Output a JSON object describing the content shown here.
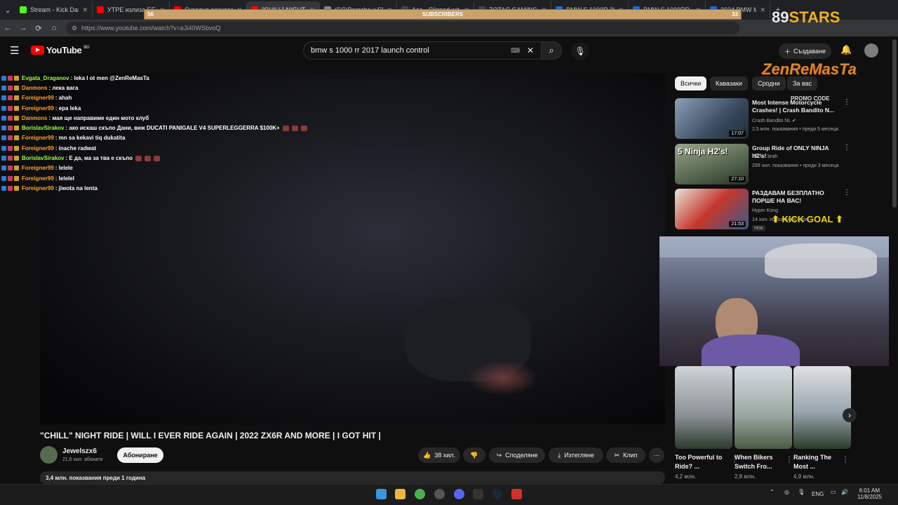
{
  "browser": {
    "tabs": [
      {
        "label": "Stream - Kick Dashb",
        "color": "#53fc18"
      },
      {
        "label": "УТРЕ излиза EЕ",
        "color": "#ff0000"
      },
      {
        "label": "Скрояна разкове",
        "color": "#ff0000"
      },
      {
        "label": "\"CHILL\" NIGHT...",
        "color": "#ff0000"
      },
      {
        "label": "(SC)Porsche x SMF",
        "color": "#888888"
      },
      {
        "label": "Ace - Clipped wit",
        "color": "#444444"
      },
      {
        "label": "ZOTAC GAMING G",
        "color": "#444444"
      },
      {
        "label": "BMW S 1000R 201",
        "color": "#1c69d4"
      },
      {
        "label": "BMW S 1000RR V",
        "color": "#1c69d4"
      },
      {
        "label": "2024 BMW M 1000",
        "color": "#1c69d4"
      }
    ],
    "url": "https://www.youtube.com/watch?v=eJi40WSbvoQ"
  },
  "youtube": {
    "logo_text": "YouTube",
    "region": "BG",
    "search_value": "bmw s 1000 rr 2017 launch control",
    "create_label": "Създаване"
  },
  "chat": [
    {
      "user": "Evgata_Draganov",
      "msg": ": leka I ot men @ZenReMasTa",
      "color": "#9cff4a",
      "emotes": 0
    },
    {
      "user": "Danmons",
      "msg": ": лека вага",
      "color": "#ff9f2e",
      "emotes": 0
    },
    {
      "user": "Foreigner99",
      "msg": ": ahah",
      "color": "#ff9f2e",
      "emotes": 0
    },
    {
      "user": "Foreigner99",
      "msg": ": epa leka",
      "color": "#ff9f2e",
      "emotes": 0
    },
    {
      "user": "Danmons",
      "msg": ": мая ще направиме един мото клуб",
      "color": "#ff9f2e",
      "emotes": 0
    },
    {
      "user": "BorislavSirakov",
      "msg": ": ако искаш скъпо Дани, виж DUCATI PANIGALE V4 SUPERLEGGERRA $100K+",
      "color": "#9cff4a",
      "emotes": 3
    },
    {
      "user": "Foreigner99",
      "msg": ": mn sa kekavi tiq dukatita",
      "color": "#ff9f2e",
      "emotes": 0
    },
    {
      "user": "Foreigner99",
      "msg": ": inache radwat",
      "color": "#ff9f2e",
      "emotes": 0
    },
    {
      "user": "BorislavSirakov",
      "msg": ": Е да, ма за тва е скъпо",
      "color": "#9cff4a",
      "emotes": 3
    },
    {
      "user": "Foreigner99",
      "msg": ": lelele",
      "color": "#ff9f2e",
      "emotes": 0
    },
    {
      "user": "Foreigner99",
      "msg": ": lelelel",
      "color": "#ff9f2e",
      "emotes": 0
    },
    {
      "user": "Foreigner99",
      "msg": ": jiwota na lenta",
      "color": "#ff9f2e",
      "emotes": 0
    }
  ],
  "video": {
    "title": "\"CHILL\" NIGHT RIDE | WILL I EVER RIDE AGAIN | 2022 ZX6R AND MORE | I GOT HIT |",
    "channel": "Jewelszx6",
    "subscribers": "21,6 хил. абонати",
    "subscribe_label": "Абониране",
    "likes": "38 хил.",
    "share_label": "Споделяне",
    "download_label": "Изтегляне",
    "clip_label": "Клип",
    "description_meta": "3,4 млн. показвания  преди 1 година"
  },
  "chips": [
    "Всички",
    "Кавазаки",
    "Сродни",
    "За вас"
  ],
  "recommendations": [
    {
      "title": "Most Intense Motorcycle Crashes! | Crash Bandito N...",
      "channel": "Crash Bandito NL",
      "meta": "2,5 млн. показвания • преди 5 месеца",
      "duration": "17:07",
      "badge": ""
    },
    {
      "title": "Group Ride of ONLY NINJA H2's!",
      "channel": "Gixxer brah",
      "meta": "299 хил. показвания • преди 3 месеца",
      "duration": "27:10",
      "badge": ""
    },
    {
      "title": "РАЗДАВАМ БЕЗПЛАТНО ПОРШЕ НА ВАС!",
      "channel": "Hyper Kong",
      "meta": "14 хил. показвания • преди 11 часа",
      "duration": "21:53",
      "badge": "Нов"
    }
  ],
  "shorts": [
    {
      "title": "Too Powerful to Ride? ...",
      "views": "4,2 млн."
    },
    {
      "title": "When Bikers Switch Fro...",
      "views": "2,8 млн."
    },
    {
      "title": "Ranking The Most ...",
      "views": "4,9 млн."
    }
  ],
  "overlay": {
    "subscribers_label": "SUBSCRIBERS",
    "sub_left": "56",
    "sub_right": "33",
    "stars_num": "89",
    "stars_word": "STARS",
    "brand": "ZenReMasTa",
    "promo": "PROMO CODE",
    "kick_goal": "KICK GOAL"
  },
  "taskbar": {
    "lang": "ENG",
    "time": "6:01 AM",
    "date": "11/8/2025"
  }
}
